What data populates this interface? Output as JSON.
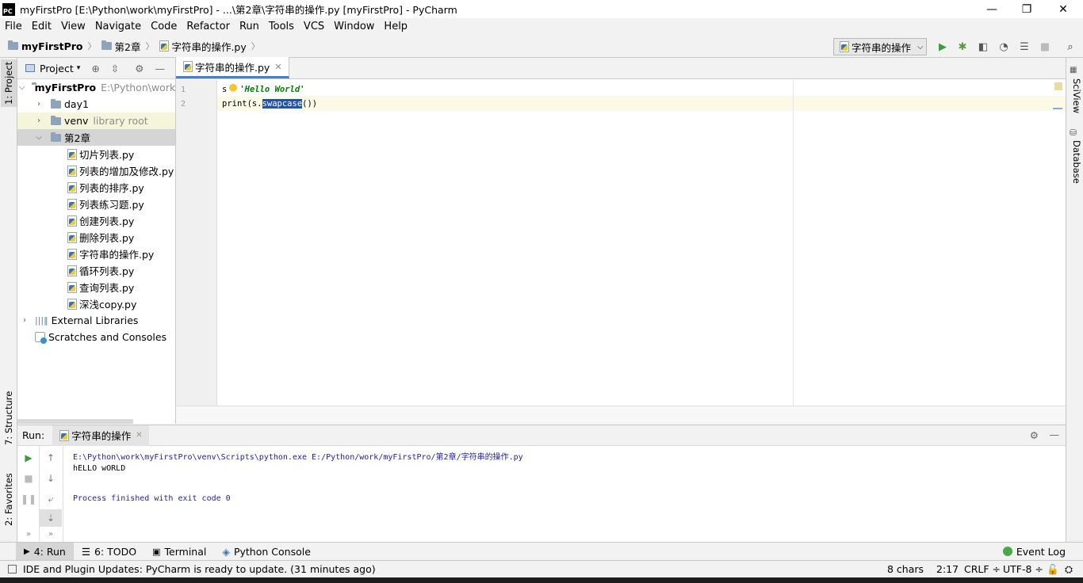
{
  "window": {
    "title": "myFirstPro [E:\\Python\\work\\myFirstPro] - ...\\第2章\\字符串的操作.py [myFirstPro] - PyCharm",
    "minimize": "—",
    "restore": "❐",
    "close": "✕"
  },
  "menu": [
    "File",
    "Edit",
    "View",
    "Navigate",
    "Code",
    "Refactor",
    "Run",
    "Tools",
    "VCS",
    "Window",
    "Help"
  ],
  "breadcrumb": {
    "project": "myFirstPro",
    "folder": "第2章",
    "file": "字符串的操作.py"
  },
  "run_config": {
    "label": "字符串的操作",
    "arrow": "⌵"
  },
  "left_strip": {
    "project": "1: Project",
    "structure": "7: Structure",
    "favorites": "2: Favorites"
  },
  "right_strip": {
    "sciview": "SciView",
    "database": "Database"
  },
  "project_panel": {
    "header": "Project",
    "root": {
      "name": "myFirstPro",
      "path": "E:\\Python\\work"
    },
    "day1": "day1",
    "venv": {
      "name": "venv",
      "note": "library root"
    },
    "chapter": "第2章",
    "files": [
      "切片列表.py",
      "列表的增加及修改.py",
      "列表的排序.py",
      "列表练习题.py",
      "创建列表.py",
      "删除列表.py",
      "字符串的操作.py",
      "循环列表.py",
      "查询列表.py",
      "深浅copy.py"
    ],
    "external": "External Libraries",
    "scratches": "Scratches and Consoles"
  },
  "editor": {
    "tab": "字符串的操作.py",
    "lines": {
      "n1": "1",
      "n2": "2",
      "l1_var": "s",
      "l1_str": "'Hello World'",
      "l2_pre": "print(s.",
      "l2_sel": "swapcase",
      "l2_post": "())"
    }
  },
  "run_panel": {
    "label": "Run:",
    "tab": "字符串的操作",
    "output": {
      "cmd": "E:\\Python\\work\\myFirstPro\\venv\\Scripts\\python.exe E:/Python/work/myFirstPro/第2章/字符串的操作.py",
      "result": "hELLO wORLD",
      "exit": "Process finished with exit code 0"
    }
  },
  "bottom_tabs": {
    "run": "4: Run",
    "todo": "6: TODO",
    "terminal": "Terminal",
    "console": "Python Console",
    "event_log": "Event Log"
  },
  "status": {
    "message": "IDE and Plugin Updates: PyCharm is ready to update. (31 minutes ago)",
    "chars": "8 chars",
    "position": "2:17",
    "line_sep": "CRLF ÷",
    "encoding": "UTF-8 ÷"
  },
  "colors": {
    "accent": "#4083c9",
    "selection": "#2153a8",
    "string": "#008000",
    "keyword": "#000080"
  }
}
